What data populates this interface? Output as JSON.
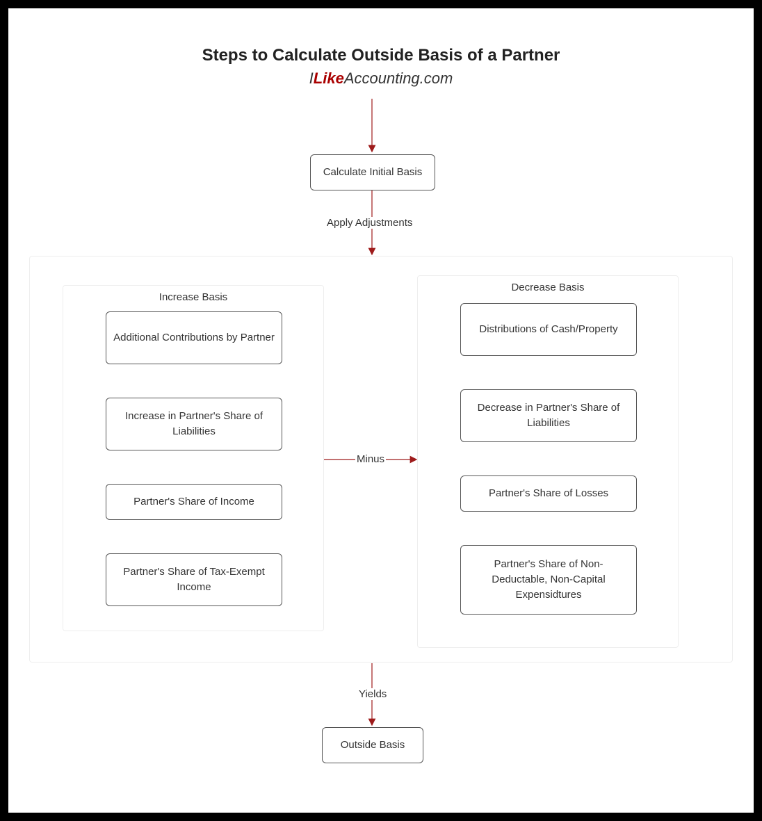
{
  "title": "Steps to Calculate Outside Basis of a Partner",
  "subtitle": {
    "i": "I",
    "like": "Like",
    "rest": "Accounting.com"
  },
  "nodes": {
    "initial": "Calculate Initial Basis",
    "outside": "Outside Basis"
  },
  "edges": {
    "apply": "Apply Adjustments",
    "minus": "Minus",
    "yields": "Yields"
  },
  "groups": {
    "increase": {
      "title": "Increase Basis",
      "items": [
        "Additional Contributions by Partner",
        "Increase in Partner's Share of Liabilities",
        "Partner's Share of Income",
        "Partner's Share of Tax-Exempt Income"
      ]
    },
    "decrease": {
      "title": "Decrease Basis",
      "items": [
        "Distributions of Cash/Property",
        "Decrease in Partner's Share of Liabilities",
        "Partner's Share of Losses",
        "Partner's Share of Non-Deductable, Non-Capital Expensidtures"
      ]
    }
  },
  "colors": {
    "accent": "#a00000",
    "arrow": "#9e1b1b"
  }
}
